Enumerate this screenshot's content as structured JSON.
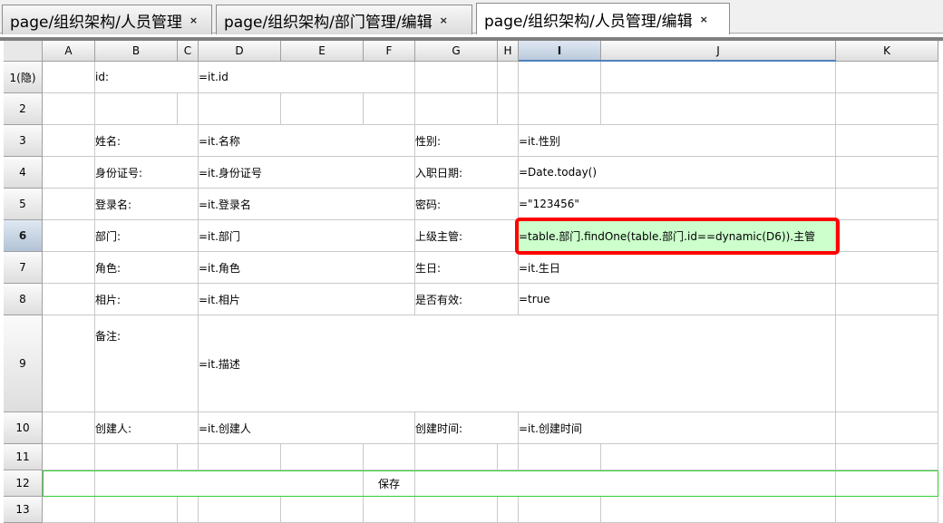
{
  "tabs": [
    {
      "label": "page/组织架构/人员管理",
      "close": "×",
      "active": false
    },
    {
      "label": "page/组织架构/部门管理/编辑",
      "close": "×",
      "active": false
    },
    {
      "label": "page/组织架构/人员管理/编辑",
      "close": "×",
      "active": true
    }
  ],
  "sheet": {
    "columns": [
      "A",
      "B",
      "C",
      "D",
      "E",
      "F",
      "G",
      "H",
      "I",
      "J",
      "K"
    ],
    "selected_column": "I",
    "rows": [
      "1(隐)",
      "2",
      "3",
      "4",
      "5",
      "6",
      "7",
      "8",
      "9",
      "10",
      "11",
      "12",
      "13"
    ],
    "selected_row": "6",
    "cells": {
      "B1": "id:",
      "D1": "=it.id",
      "B3": "姓名:",
      "D3": "=it.名称",
      "G3": "性别:",
      "I3": "=it.性别",
      "B4": "身份证号:",
      "D4": "=it.身份证号",
      "G4": "入职日期:",
      "I4": "=Date.today()",
      "B5": "登录名:",
      "D5": "=it.登录名",
      "G5": "密码:",
      "I5": "=\"123456\"",
      "B6": "部门:",
      "D6": "=it.部门",
      "G6": "上级主管:",
      "I6": "=table.部门.findOne(table.部门.id==dynamic(D6)).主管",
      "B7": "角色:",
      "D7": "=it.角色",
      "G7": "生日:",
      "I7": "=it.生日",
      "B8": "相片:",
      "D8": "=it.相片",
      "G8": "是否有效:",
      "I8": "=true",
      "B9": "备注:",
      "D9": "=it.描述",
      "B10": "创建人:",
      "D10": "=it.创建人",
      "G10": "创建时间:",
      "I10": "=it.创建时间",
      "F12": "保存"
    }
  },
  "colors": {
    "highlight_fill": "#ccffcc",
    "highlight_outline": "#ff0000",
    "save_row_border": "#33cc33",
    "selection_header": "#b9c9da"
  }
}
